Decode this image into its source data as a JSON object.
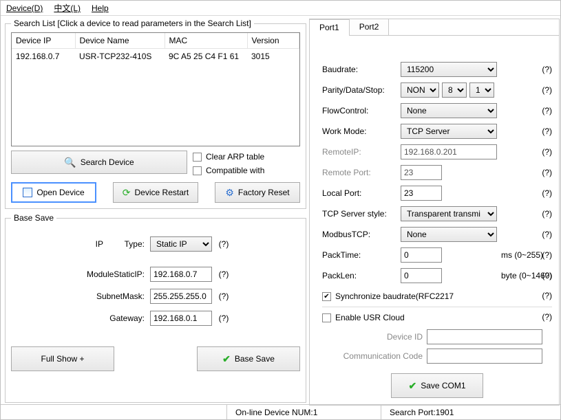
{
  "menu": {
    "device": "Device(D)",
    "lang": "中文(L)",
    "help": "Help"
  },
  "searchList": {
    "legend": "Search List [Click a device to read parameters in the Search List]",
    "headers": {
      "ip": "Device IP",
      "name": "Device Name",
      "mac": "MAC",
      "ver": "Version"
    },
    "rows": [
      {
        "ip": "192.168.0.7",
        "name": "USR-TCP232-410S",
        "mac": "9C A5 25 C4 F1 61",
        "ver": "3015"
      }
    ],
    "searchBtn": "Search Device",
    "clearArp": "Clear ARP table",
    "compat": "Compatible with",
    "openDevice": "Open Device",
    "restart": "Device Restart",
    "factory": "Factory Reset"
  },
  "baseSave": {
    "legend": "Base Save",
    "ipLbl": "IP",
    "typeLbl": "Type:",
    "typeVal": "Static IP",
    "staticIpLbl": "ModuleStaticIP:",
    "staticIpVal": "192.168.0.7",
    "subnetLbl": "SubnetMask:",
    "subnetVal": "255.255.255.0",
    "gatewayLbl": "Gateway:",
    "gatewayVal": "192.168.0.1",
    "fullShow": "Full Show  +",
    "baseSaveBtn": "Base Save",
    "help": "(?)"
  },
  "tabs": {
    "port1": "Port1",
    "port2": "Port2"
  },
  "port": {
    "baudLbl": "Baudrate:",
    "baudVal": "115200",
    "pdsLbl": "Parity/Data/Stop:",
    "parity": "NONE",
    "data": "8",
    "stop": "1",
    "flowLbl": "FlowControl:",
    "flowVal": "None",
    "workLbl": "Work Mode:",
    "workVal": "TCP Server",
    "ripLbl": "RemoteIP:",
    "ripVal": "192.168.0.201",
    "rportLbl": "Remote Port:",
    "rportVal": "23",
    "lportLbl": "Local Port:",
    "lportVal": "23",
    "tcpStyleLbl": "TCP Server style:",
    "tcpStyleVal": "Transparent transmi",
    "modbusLbl": "ModbusTCP:",
    "modbusVal": "None",
    "packTimeLbl": "PackTime:",
    "packTimeVal": "0",
    "packTimeUnit": "ms (0~255)",
    "packLenLbl": "PackLen:",
    "packLenVal": "0",
    "packLenUnit": "byte (0~1460)",
    "syncBaud": "Synchronize baudrate(RFC2217",
    "enableCloud": "Enable USR Cloud",
    "devIdLbl": "Device ID",
    "devIdVal": "",
    "commCodeLbl": "Communication Code",
    "commCodeVal": "",
    "saveCom": "Save COM1",
    "help": "(?)"
  },
  "status": {
    "online": "On-line Device NUM:1",
    "searchPort": "Search Port:1901"
  }
}
